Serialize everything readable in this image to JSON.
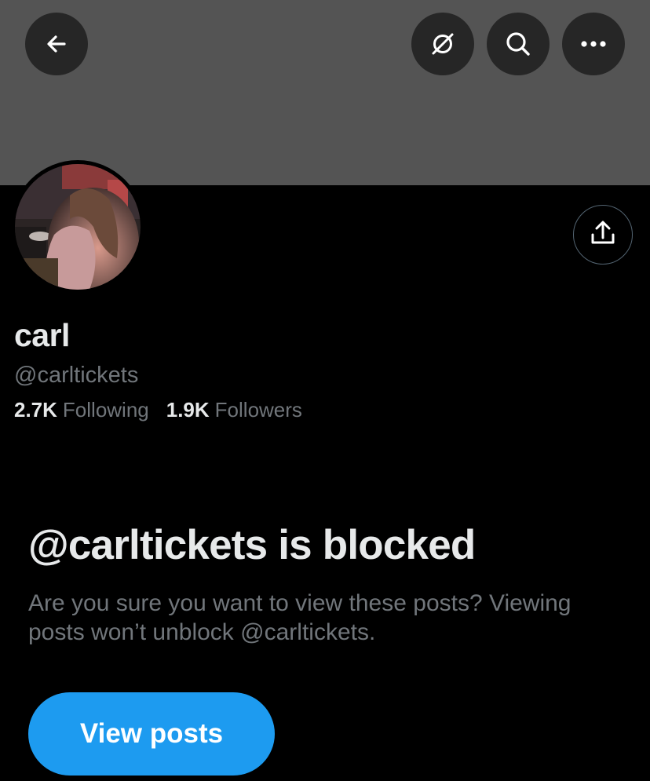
{
  "header": {
    "back_icon": "arrow-left-icon",
    "grok_icon": "grok-icon",
    "search_icon": "search-icon",
    "more_icon": "more-horizontal-icon",
    "banner_color": "#545454"
  },
  "profile": {
    "share_icon": "share-upload-icon",
    "avatar_icon": "profile-photo",
    "display_name": "carl",
    "handle": "@carltickets",
    "following_count": "2.7K",
    "following_label": "Following",
    "followers_count": "1.9K",
    "followers_label": "Followers"
  },
  "blocked": {
    "title": "@carltickets is blocked",
    "description": "Are you sure you want to view these posts? Viewing posts won’t unblock @carltickets.",
    "view_button_label": "View posts",
    "button_color": "#1d9bf0"
  }
}
